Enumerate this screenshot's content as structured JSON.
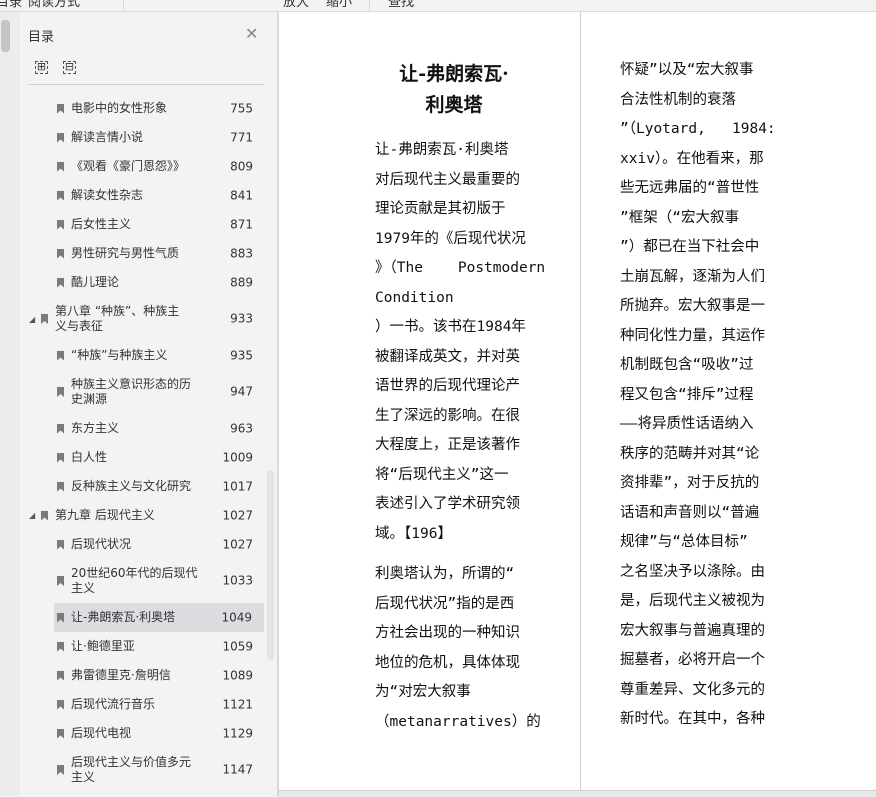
{
  "toolbar": {
    "items": [
      "目录",
      "阅读方式",
      "放大",
      "缩小",
      "查找"
    ]
  },
  "sidebar": {
    "title": "目录",
    "expand_all": "⊞",
    "collapse_all": "⊟",
    "items": [
      {
        "label": "电影中的女性形象",
        "page": "755",
        "level": 2
      },
      {
        "label": "解读言情小说",
        "page": "771",
        "level": 2
      },
      {
        "label": "《观看《豪门恩怨》》",
        "page": "809",
        "level": 2
      },
      {
        "label": "解读女性杂志",
        "page": "841",
        "level": 2
      },
      {
        "label": "后女性主义",
        "page": "871",
        "level": 2
      },
      {
        "label": "男性研究与男性气质",
        "page": "883",
        "level": 2
      },
      {
        "label": "酷儿理论",
        "page": "889",
        "level": 2
      },
      {
        "label": "第八章 “种族”、种族主义与表征",
        "page": "933",
        "level": 1
      },
      {
        "label": "“种族”与种族主义",
        "page": "935",
        "level": 2
      },
      {
        "label": "种族主义意识形态的历史渊源",
        "page": "947",
        "level": 2
      },
      {
        "label": "东方主义",
        "page": "963",
        "level": 2
      },
      {
        "label": "白人性",
        "page": "1009",
        "level": 2
      },
      {
        "label": "反种族主义与文化研究",
        "page": "1017",
        "level": 2
      },
      {
        "label": "第九章 后现代主义",
        "page": "1027",
        "level": 1
      },
      {
        "label": "后现代状况",
        "page": "1027",
        "level": 2
      },
      {
        "label": "20世纪60年代的后现代主义",
        "page": "1033",
        "level": 2
      },
      {
        "label": "让-弗朗索瓦·利奥塔",
        "page": "1049",
        "level": 2,
        "selected": true
      },
      {
        "label": "让·鲍德里亚",
        "page": "1059",
        "level": 2
      },
      {
        "label": "弗雷德里克·詹明信",
        "page": "1089",
        "level": 2
      },
      {
        "label": "后现代流行音乐",
        "page": "1121",
        "level": 2
      },
      {
        "label": "后现代电视",
        "page": "1129",
        "level": 2
      },
      {
        "label": "后现代主义与价值多元主义",
        "page": "1147",
        "level": 2
      }
    ]
  },
  "document": {
    "title_lines": [
      "让-弗朗索瓦·",
      "利奥塔"
    ],
    "left_para1": [
      "让-弗朗索瓦·利奥塔",
      "对后现代主义最重要的",
      "理论贡献是其初版于",
      "1979年的《后现代状况",
      "》（The    Postmodern",
      "Condition",
      "）一书。该书在1984年",
      "被翻译成英文，并对英",
      "语世界的后现代理论产",
      "生了深远的影响。在很",
      "大程度上，正是该著作",
      "将“后现代主义”这一",
      "表述引入了学术研究领",
      "域。【196】"
    ],
    "left_para2": [
      "利奥塔认为，所谓的“",
      "后现代状况”指的是西",
      "方社会出现的一种知识",
      "地位的危机，具体体现",
      "为“对宏大叙事",
      "（metanarratives）的"
    ],
    "right_column": [
      "怀疑”以及“宏大叙事",
      "合法性机制的衰落",
      "”（Lyotard,   1984:",
      "xxiv）。在他看来，那",
      "些无远弗届的“普世性",
      "”框架（“宏大叙事",
      "”）都已在当下社会中",
      "土崩瓦解，逐渐为人们",
      "所抛弃。宏大叙事是一",
      "种同化性力量，其运作",
      "机制既包含“吸收”过",
      "程又包含“排斥”过程",
      "——将异质性话语纳入",
      "秩序的范畴并对其“论",
      "资排辈”，对于反抗的",
      "话语和声音则以“普遍",
      "规律”与“总体目标”",
      "之名坚决予以涤除。由",
      "是，后现代主义被视为",
      "宏大叙事与普遍真理的",
      "掘墓者，必将开启一个",
      "尊重差异、文化多元的",
      "新时代。在其中，各种"
    ]
  }
}
